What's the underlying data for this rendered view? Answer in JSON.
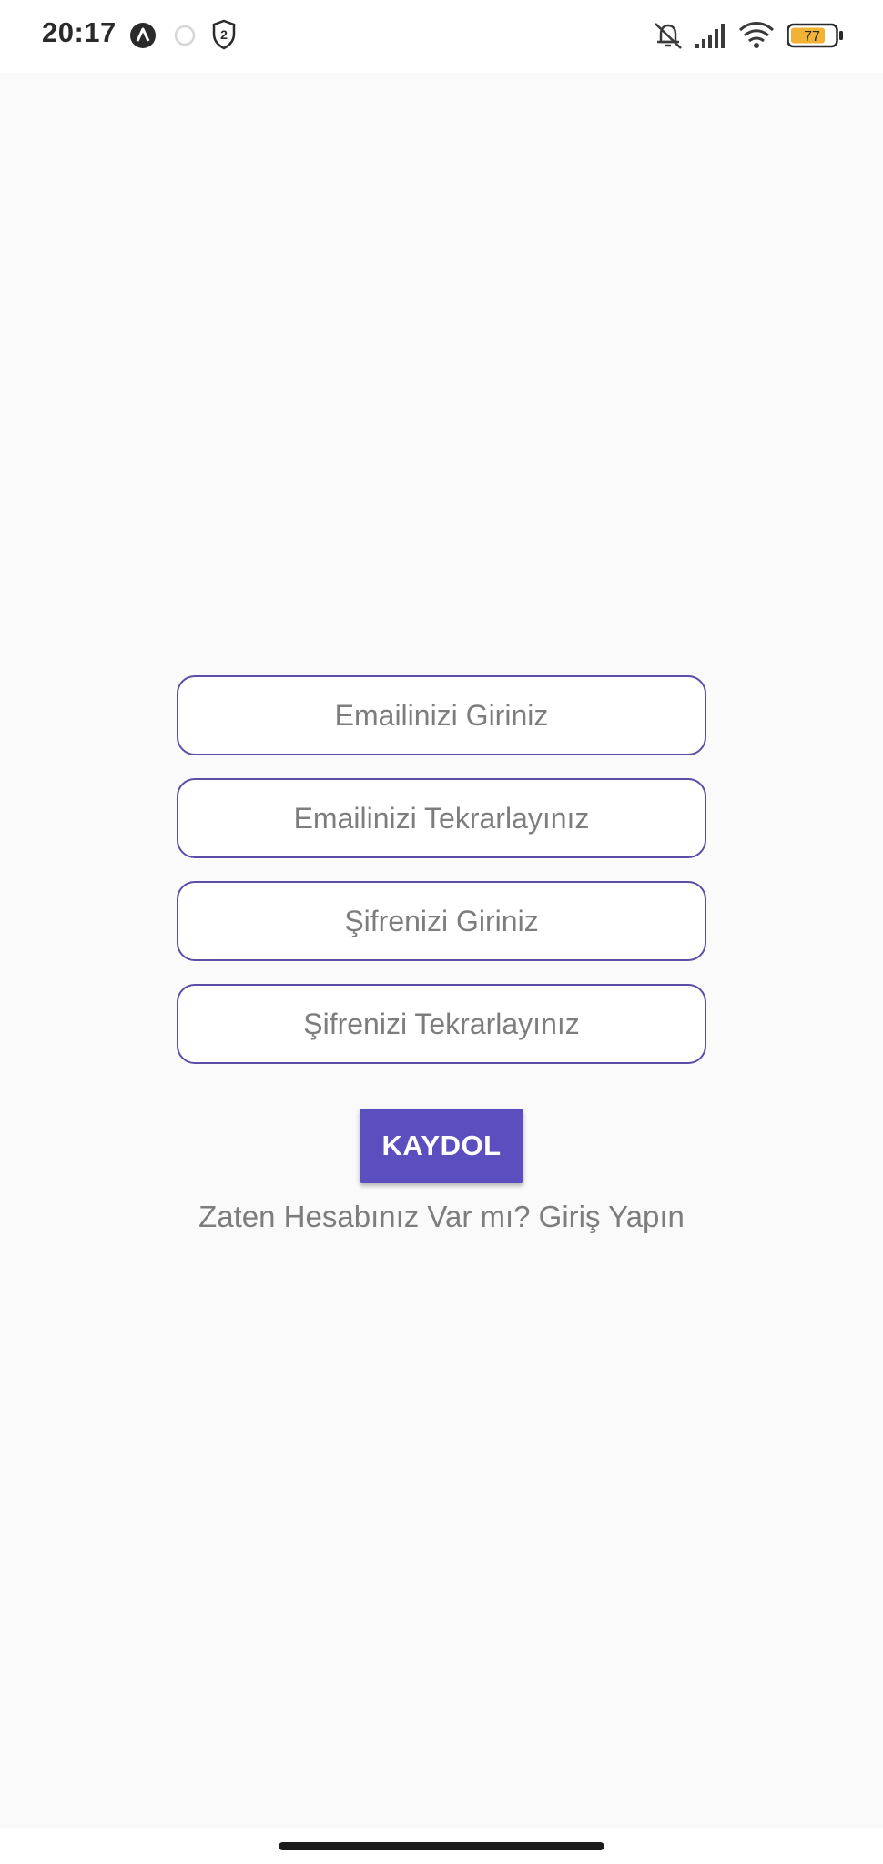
{
  "status_bar": {
    "time": "20:17",
    "shield_count": "2",
    "battery_level": "77",
    "battery_color": "#f2b233"
  },
  "form": {
    "email_placeholder": "Emailinizi Giriniz",
    "email_value": "",
    "email_repeat_placeholder": "Emailinizi Tekrarlayınız",
    "email_repeat_value": "",
    "password_placeholder": "Şifrenizi Giriniz",
    "password_value": "",
    "password_repeat_placeholder": "Şifrenizi Tekrarlayınız",
    "password_repeat_value": "",
    "submit_label": "KAYDOL",
    "login_link": "Zaten Hesabınız Var mı? Giriş Yapın"
  },
  "colors": {
    "accent": "#5b4fc0",
    "field_border": "#5b4ea6",
    "placeholder_text": "#7d7d7d"
  }
}
